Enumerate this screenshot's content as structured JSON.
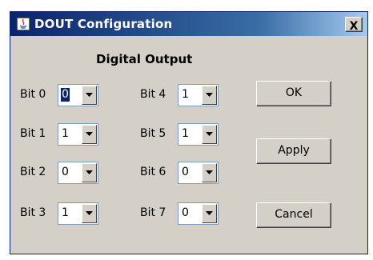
{
  "window": {
    "title": "DOUT Configuration",
    "close_label": "X"
  },
  "heading": "Digital Output",
  "bits": [
    {
      "label": "Bit 0",
      "value": "0"
    },
    {
      "label": "Bit 1",
      "value": "1"
    },
    {
      "label": "Bit 2",
      "value": "0"
    },
    {
      "label": "Bit 3",
      "value": "1"
    },
    {
      "label": "Bit 4",
      "value": "1"
    },
    {
      "label": "Bit 5",
      "value": "1"
    },
    {
      "label": "Bit 6",
      "value": "0"
    },
    {
      "label": "Bit 7",
      "value": "0"
    }
  ],
  "buttons": {
    "ok": "OK",
    "apply": "Apply",
    "cancel": "Cancel"
  },
  "colors": {
    "titlebar_start": "#0a246a",
    "titlebar_end": "#a6caf0",
    "dialog_bg": "#d4d0c8",
    "selection": "#0a246a"
  }
}
